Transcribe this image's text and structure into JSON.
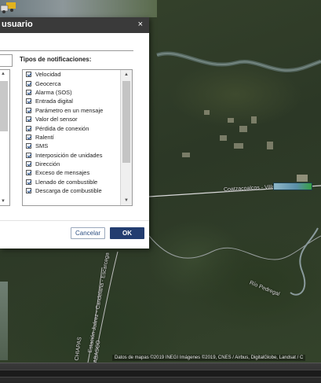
{
  "dialog": {
    "title": "usuario",
    "close_symbol": "×",
    "notifications_label": "Tipos de notificaciones:",
    "notification_types": [
      "Velocidad",
      "Geocerca",
      "Alarma (SOS)",
      "Entrada digital",
      "Parámetro en un mensaje",
      "Valor del sensor",
      "Pérdida de conexión",
      "Ralentí",
      "SMS",
      "Interposición de unidades",
      "Dirección",
      "Exceso de mensajes",
      "Llenado de combustible",
      "Descarga de combustible"
    ],
    "cancel_label": "Cancelar",
    "ok_label": "OK"
  },
  "map": {
    "labels": {
      "coatzacoalcos": "Coatzacoalcos - Villa...",
      "rio": "Río Pedregal",
      "road_left": "Estación Juárez - Candelaria - Escarcega",
      "chiapas": "CHIAPAS",
      "abasco": "ABASCO"
    },
    "attribution": "Datos de mapas ©2019 INEGI Imágenes ©2019, CNES / Airbus, DigitalGlobe, Landsat / C"
  },
  "colors": {
    "header_bg": "#3a3a3a",
    "ok_bg": "#233d70",
    "cancel_text": "#2d4f82"
  }
}
